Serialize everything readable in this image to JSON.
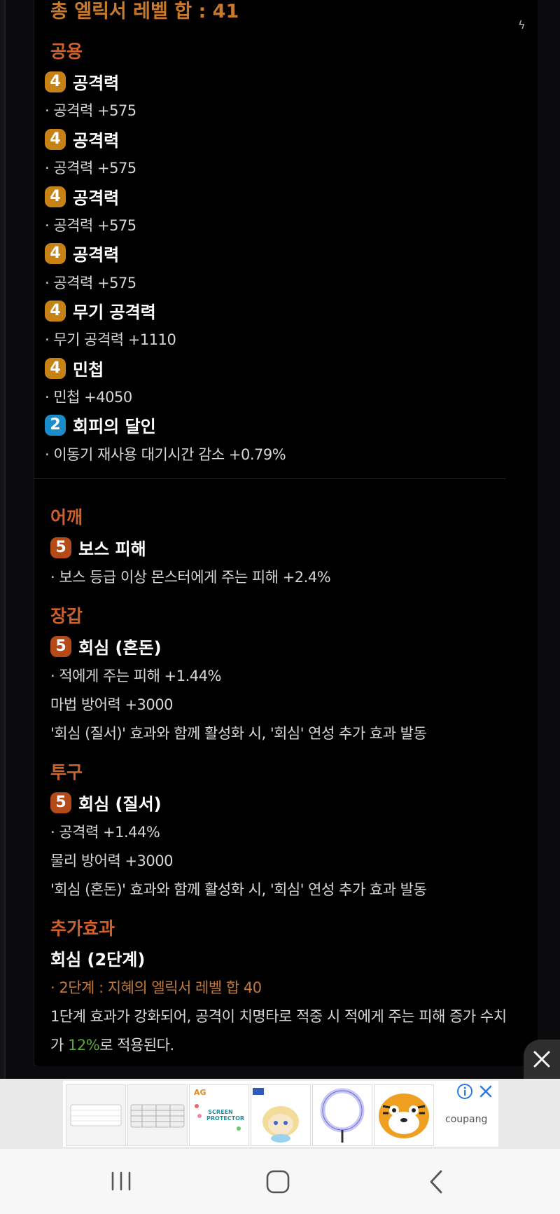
{
  "header": {
    "title": "총 엘릭서 레벨 합 : 41"
  },
  "sections": {
    "common": {
      "heading": "공용",
      "items": [
        {
          "level": "4",
          "name": "공격력",
          "effect": "· 공격력 +575"
        },
        {
          "level": "4",
          "name": "공격력",
          "effect": "· 공격력 +575"
        },
        {
          "level": "4",
          "name": "공격력",
          "effect": "· 공격력 +575"
        },
        {
          "level": "4",
          "name": "공격력",
          "effect": "· 공격력 +575"
        },
        {
          "level": "4",
          "name": "무기 공격력",
          "effect": "· 무기 공격력 +1110"
        },
        {
          "level": "4",
          "name": "민첩",
          "effect": "· 민첩 +4050"
        },
        {
          "level": "2",
          "name": "회피의 달인",
          "effect": "· 이동기 재사용 대기시간 감소 +0.79%"
        }
      ]
    },
    "shoulder": {
      "heading": "어깨",
      "item": {
        "level": "5",
        "name": "보스 피해",
        "effect": "· 보스 등급 이상 몬스터에게 주는 피해 +2.4%"
      }
    },
    "gloves": {
      "heading": "장갑",
      "item": {
        "level": "5",
        "name": "회심 (혼돈)",
        "effect": "· 적에게 주는 피해 +1.44%"
      },
      "extra1": "마법 방어력 +3000",
      "extra2": "'회심 (질서)' 효과와 함께 활성화 시, '회심' 연성 추가 효과 발동"
    },
    "helmet": {
      "heading": "투구",
      "item": {
        "level": "5",
        "name": "회심 (질서)",
        "effect": "· 공격력 +1.44%"
      },
      "extra1": "물리 방어력 +3000",
      "extra2": "'회심 (혼돈)' 효과와 함께 활성화 시, '회심' 연성 추가 효과 발동"
    },
    "bonus": {
      "heading": "추가효과",
      "name": "회심 (2단계)",
      "condition": "· 2단계 : 지혜의 엘릭서 레벨 합 40",
      "desc_line1": "1단계 효과가 강화되어, 공격이 치명타로 적중 시 적에게 주는 피해 증가 수치",
      "desc_prefix": "가 ",
      "desc_value": "12%",
      "desc_suffix": "로 적용된다."
    }
  },
  "ad": {
    "brand": "coupang",
    "thumb3_text": "SCREEN PROTECTOR",
    "thumb3_logo": "AG"
  },
  "colors": {
    "accent_orange": "#c77a2e",
    "section": "#d0602a",
    "badge_gold": "#c68214",
    "badge_blue": "#1a8cc9",
    "badge_rust": "#b34a17",
    "highlight_green": "#5aa83a"
  }
}
